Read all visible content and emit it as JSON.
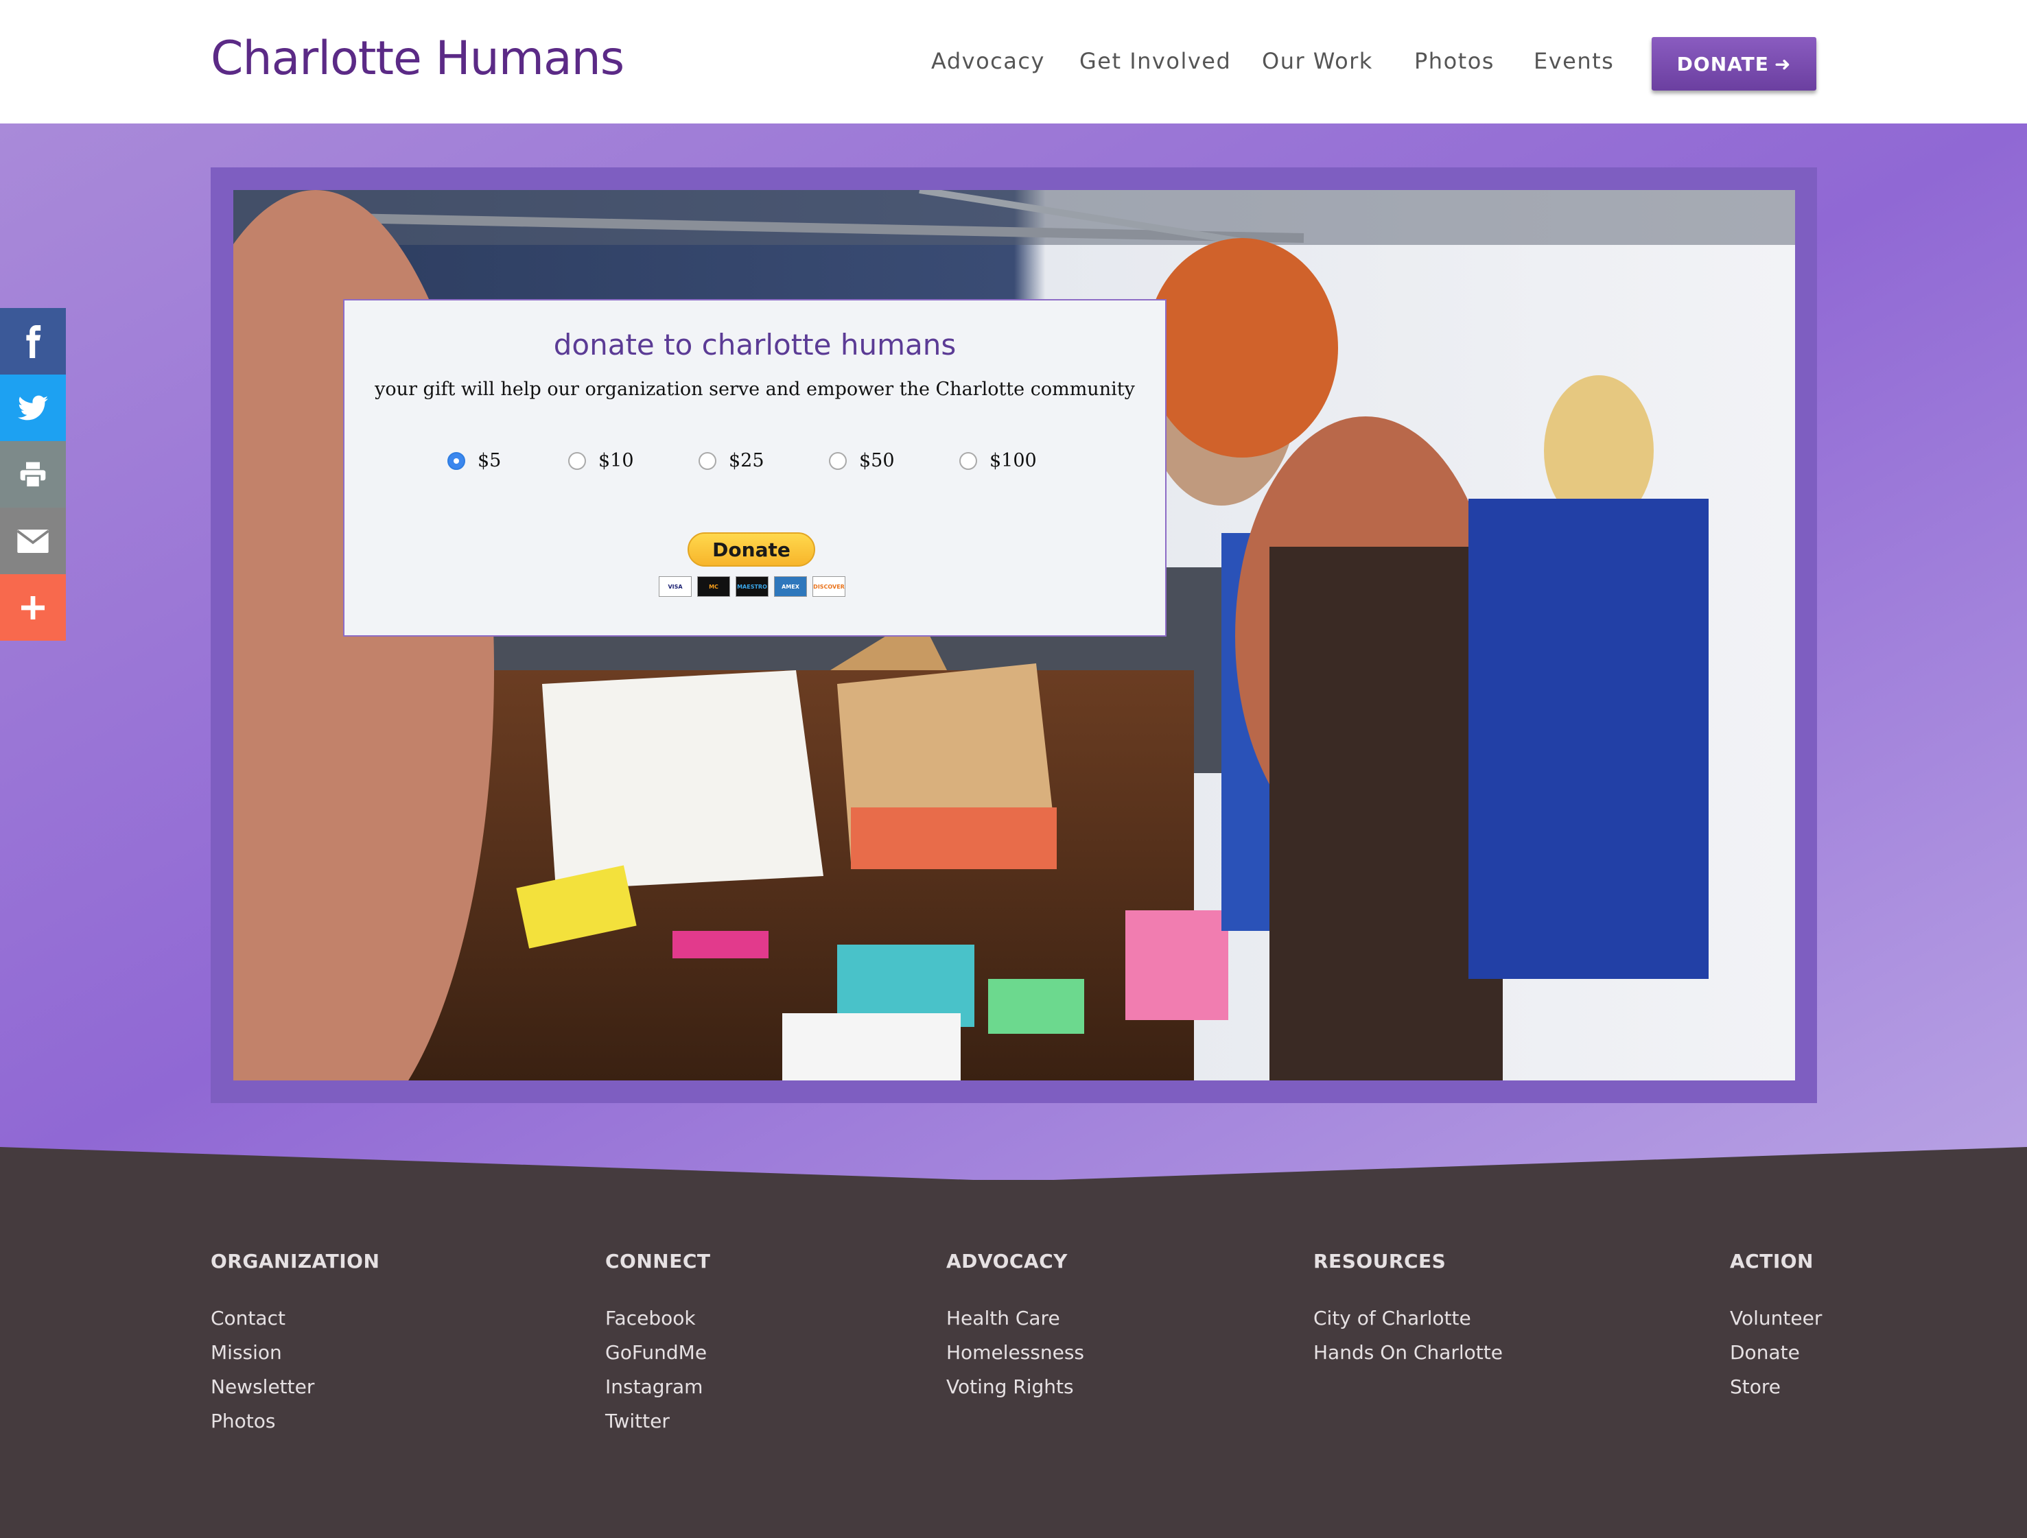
{
  "header": {
    "logo": "Charlotte Humans",
    "nav": [
      "Advocacy",
      "Get Involved",
      "Our Work",
      "Photos",
      "Events"
    ],
    "donate_label": "DONATE",
    "donate_arrow": "➜"
  },
  "donate_card": {
    "title": "donate to charlotte humans",
    "subtitle": "your gift will help our organization serve and empower the Charlotte community",
    "amounts": [
      "$5",
      "$10",
      "$25",
      "$50",
      "$100"
    ],
    "selected_amount": "$5",
    "button_label": "Donate",
    "card_logos": [
      "VISA",
      "MC",
      "MAESTRO",
      "AMEX",
      "DISCOVER"
    ]
  },
  "social": [
    "facebook-icon",
    "twitter-icon",
    "print-icon",
    "email-icon",
    "plus-icon"
  ],
  "footer": {
    "columns": [
      {
        "heading": "ORGANIZATION",
        "links": [
          "Contact",
          "Mission",
          "Newsletter",
          "Photos"
        ]
      },
      {
        "heading": "CONNECT",
        "links": [
          "Facebook",
          "GoFundMe",
          "Instagram",
          "Twitter"
        ]
      },
      {
        "heading": "ADVOCACY",
        "links": [
          "Health Care",
          "Homelessness",
          "Voting Rights"
        ]
      },
      {
        "heading": "RESOURCES",
        "links": [
          "City of Charlotte",
          "Hands On Charlotte"
        ]
      },
      {
        "heading": "ACTION",
        "links": [
          "Volunteer",
          "Donate",
          "Store"
        ]
      }
    ]
  },
  "colors": {
    "brand": "#5b2a86",
    "hero": "#9068d4",
    "footer": "#453b3e",
    "facebook": "#3b5998",
    "twitter": "#1da1f2",
    "print": "#7d8a8a",
    "email": "#848484",
    "plus": "#f8694d"
  }
}
